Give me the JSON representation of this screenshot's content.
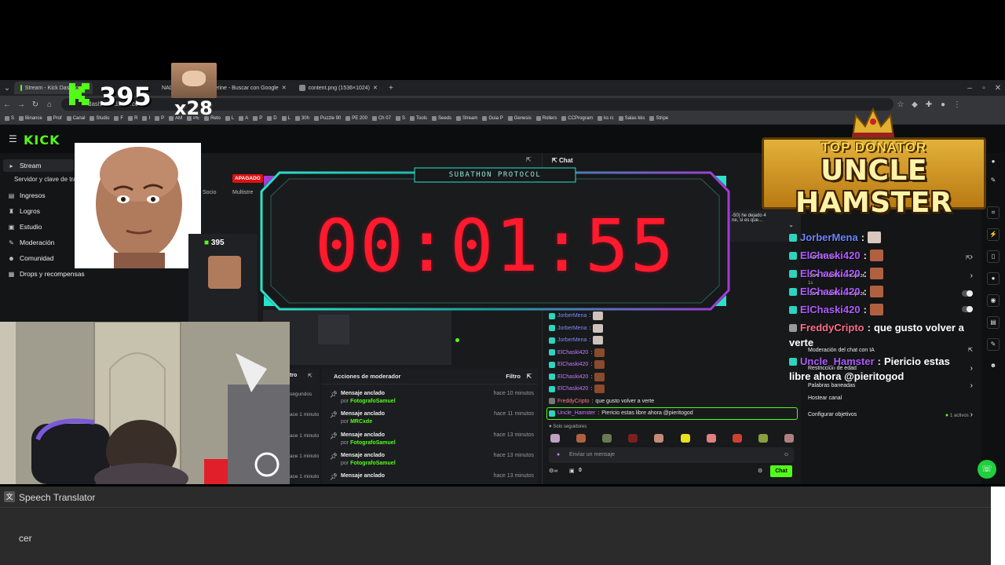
{
  "browser": {
    "tabs": [
      {
        "label": "Stream - Kick Dashboard",
        "active": true
      },
      {
        "label": "NADA.png (",
        "active": false
      },
      {
        "label": "wolverine - Buscar con Google",
        "active": false
      },
      {
        "label": "content.png (1536×1024)",
        "active": false
      }
    ],
    "url": "dashboard.kick.com",
    "bookmarks": [
      "S",
      "Binance",
      "Prof",
      "Canal",
      "Studio",
      "F",
      "R",
      "I",
      "P",
      "AM",
      "PE",
      "Reto",
      "L",
      "A",
      "P",
      "D",
      "L",
      "30h",
      "Puzzle 90",
      "PE 200",
      "Ch 07",
      "S",
      "Tools",
      "Seeds",
      "Stream",
      "Guia P",
      "Genesis",
      "Rollers",
      "CCProgram",
      "ks rc",
      "Salas kks",
      "Stripe"
    ]
  },
  "overlay": {
    "counter": "395",
    "multiplier": "x28",
    "timer_label": "SUBATHON PROTOCOL",
    "timer": "00:01:55",
    "donator_title": "TOP DONATOR",
    "donator_name": "UNCLE HAMSTER",
    "mini_counter": "395"
  },
  "kick": {
    "logo": "KICK",
    "sidebar": {
      "items": [
        "Stream",
        "Servidor y clave de transmisión",
        "Ingresos",
        "Logros",
        "Estudio",
        "Moderación",
        "Comunidad",
        "Drops y recompensas"
      ]
    },
    "center_tabs": [
      "Socio",
      "Multistre"
    ],
    "status_badge": "APAGADO",
    "chat_title": "Chat",
    "modal_snippet": [
      "-50) he dejado 4",
      "ne, si es que..."
    ],
    "mod_actions": {
      "title": "Acciones de moderador",
      "filter": "Filtro",
      "left_filter": "ltro",
      "left_times": [
        "segundos",
        "ace 1 minuto",
        "ace 1 minuto",
        "ace 1 minuto",
        "ace 1 minuto"
      ],
      "rows": [
        {
          "title": "Mensaje anclado",
          "by_prefix": "por",
          "by": "FotografoSamuel",
          "time": "hace 10 minutos"
        },
        {
          "title": "Mensaje anclado",
          "by_prefix": "por",
          "by": "MRCxde",
          "time": "hace 11 minutos"
        },
        {
          "title": "Mensaje anclado",
          "by_prefix": "por",
          "by": "FotografoSamuel",
          "time": "hace 13 minutos"
        },
        {
          "title": "Mensaje anclado",
          "by_prefix": "por",
          "by": "FotografoSamuel",
          "time": "hace 13 minutos"
        },
        {
          "title": "Mensaje anclado",
          "by_prefix": "",
          "by": "",
          "time": "hace 13 minutos"
        }
      ]
    },
    "chat_messages": [
      {
        "user": "JorberMena",
        "text": "",
        "color": "#7b8cff"
      },
      {
        "user": "JorberMena",
        "text": "",
        "color": "#7b8cff"
      },
      {
        "user": "JorberMena",
        "text": "",
        "color": "#7b8cff"
      },
      {
        "user": "ElChaski420",
        "text": "",
        "color": "#c879ff"
      },
      {
        "user": "ElChaski420",
        "text": "",
        "color": "#c879ff"
      },
      {
        "user": "ElChaski420",
        "text": "",
        "color": "#c879ff"
      },
      {
        "user": "ElChaski420",
        "text": "",
        "color": "#c879ff"
      },
      {
        "user": "FreddyCripto",
        "text": "que gusto volver a verte",
        "color": "#ff7a8a"
      },
      {
        "user": "Uncle_Hamster",
        "text": "Piericio estas libre ahora @pieritogod",
        "color": "#c879ff"
      }
    ],
    "followers_only": "Solo seguidores",
    "chat_placeholder": "Enviar un mensaje",
    "chat_send": "Chat",
    "viewer_count": "0",
    "settings": {
      "rows": [
        {
          "label": "Modo lento"
        },
        {
          "label": "Chat de solo-suscriptor"
        },
        {
          "label": "1s"
        },
        {
          "label": "Chat de solo-suscriptor"
        },
        {
          "label": "Moderación del chat con IA"
        },
        {
          "label": "Restricción de edad"
        },
        {
          "label": "Palabras baneadas"
        },
        {
          "label": "Hostear canal"
        },
        {
          "label": "Configurar objetivos",
          "value": "1 activos"
        }
      ]
    }
  },
  "big_chat": [
    {
      "user": "JorberMena",
      "text": "",
      "color": "#6b86ff"
    },
    {
      "user": "ElChaski420",
      "text": "",
      "color": "#b05cff"
    },
    {
      "user": "ElChaski420",
      "text": "",
      "color": "#b05cff"
    },
    {
      "user": "ElChaski420",
      "text": "",
      "color": "#b05cff"
    },
    {
      "user": "ElChaski420",
      "text": "",
      "color": "#b05cff"
    },
    {
      "user": "FreddyCripto",
      "text": "que gusto volver a",
      "cont": "verte",
      "color": "#ff6f8a"
    },
    {
      "user": "Uncle_Hamster",
      "text": "Piericio estas",
      "cont": "libre ahora @pieritogod",
      "color": "#b05cff"
    }
  ],
  "translator": {
    "title": "Speech Translator",
    "text": "cer"
  }
}
